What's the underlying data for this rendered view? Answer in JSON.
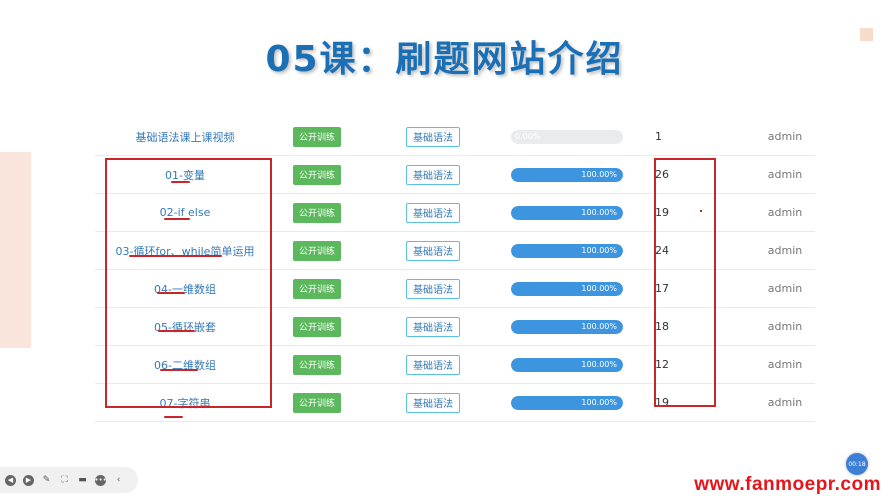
{
  "title": "05课：刷题网站介绍",
  "rows": [
    {
      "name": "基础语法课上课视频",
      "train": "公开训练",
      "category": "基础语法",
      "progress_text": "0.00%",
      "progress": 0,
      "count": "1",
      "author": "admin"
    },
    {
      "name": "01-变量",
      "train": "公开训练",
      "category": "基础语法",
      "progress_text": "100.00%",
      "progress": 100,
      "count": "26",
      "author": "admin"
    },
    {
      "name": "02-if else",
      "train": "公开训练",
      "category": "基础语法",
      "progress_text": "100.00%",
      "progress": 100,
      "count": "19",
      "author": "admin"
    },
    {
      "name": "03-循环for、while简单运用",
      "train": "公开训练",
      "category": "基础语法",
      "progress_text": "100.00%",
      "progress": 100,
      "count": "24",
      "author": "admin"
    },
    {
      "name": "04-一维数组",
      "train": "公开训练",
      "category": "基础语法",
      "progress_text": "100.00%",
      "progress": 100,
      "count": "17",
      "author": "admin"
    },
    {
      "name": "05-循环嵌套",
      "train": "公开训练",
      "category": "基础语法",
      "progress_text": "100.00%",
      "progress": 100,
      "count": "18",
      "author": "admin"
    },
    {
      "name": "06-二维数组",
      "train": "公开训练",
      "category": "基础语法",
      "progress_text": "100.00%",
      "progress": 100,
      "count": "12",
      "author": "admin"
    },
    {
      "name": "07-字符串",
      "train": "公开训练",
      "category": "基础语法",
      "progress_text": "100.00%",
      "progress": 100,
      "count": "19",
      "author": "admin"
    }
  ],
  "player": {
    "icons": [
      "prev-icon",
      "play-icon",
      "pen-icon",
      "screenshot-icon",
      "camera-icon",
      "more-icon",
      "collapse-icon"
    ]
  },
  "timer": "00:18",
  "watermark": "www.fanmoepr.com",
  "colors": {
    "accent": "#1a6fb5",
    "train_button": "#5cb85c",
    "progress": "#3d95e0",
    "annotation": "#c9262a"
  }
}
